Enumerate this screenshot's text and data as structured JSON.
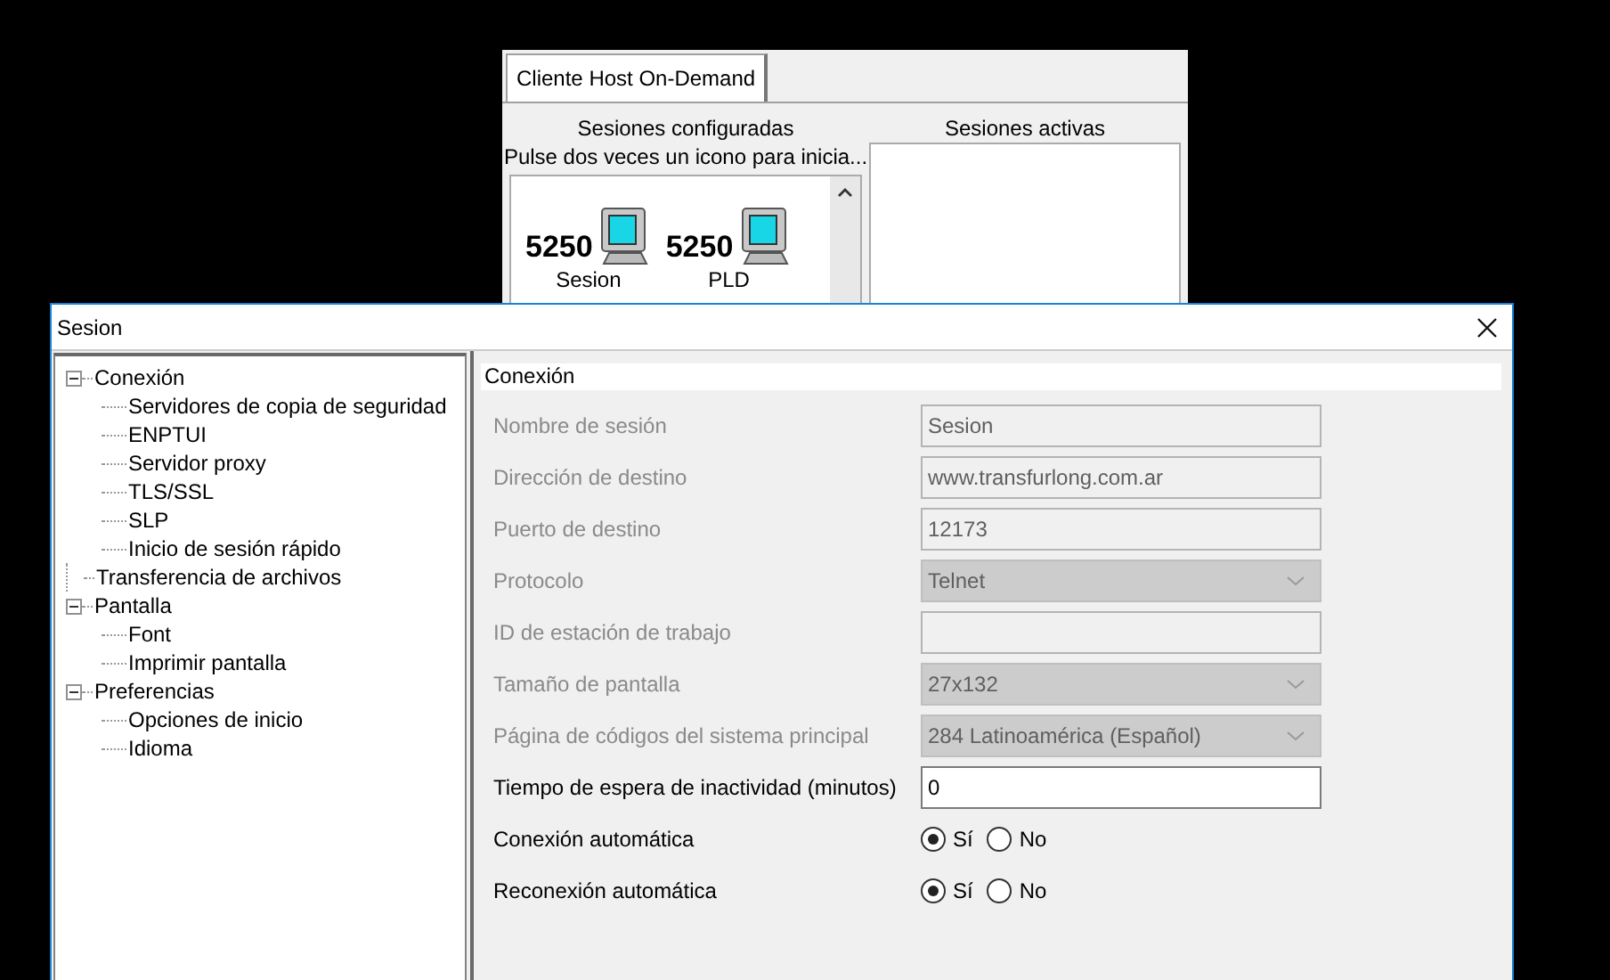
{
  "host_window": {
    "tab": "Cliente Host On-Demand",
    "configured": {
      "title": "Sesiones configuradas",
      "hint": "Pulse dos veces un icono para inicia...",
      "sessions": [
        {
          "code": "5250",
          "name": "Sesion"
        },
        {
          "code": "5250",
          "name": "PLD"
        }
      ]
    },
    "active": {
      "title": "Sesiones activas"
    }
  },
  "dialog": {
    "title": "Sesion",
    "tree": [
      {
        "label": "Conexión",
        "expanded": true,
        "selected": false,
        "children": [
          {
            "label": "Servidores de copia de seguridad",
            "selected": false
          },
          {
            "label": "ENPTUI",
            "selected": false
          },
          {
            "label": "Servidor proxy",
            "selected": false
          },
          {
            "label": "TLS/SSL",
            "selected": false
          },
          {
            "label": "SLP",
            "selected": false
          },
          {
            "label": "Inicio de sesión rápido",
            "selected": false
          }
        ]
      },
      {
        "label": "Transferencia de archivos",
        "selected": false
      },
      {
        "label": "Pantalla",
        "expanded": true,
        "selected": false,
        "children": [
          {
            "label": "Font",
            "selected": false
          },
          {
            "label": "Imprimir pantalla",
            "selected": false
          }
        ]
      },
      {
        "label": "Preferencias",
        "expanded": true,
        "selected": false,
        "children": [
          {
            "label": "Opciones de inicio",
            "selected": false
          },
          {
            "label": "Idioma",
            "selected": false
          }
        ]
      }
    ],
    "section": "Conexión",
    "fields": [
      {
        "kind": "text",
        "label": "Nombre de sesión",
        "value": "Sesion",
        "disabled": true
      },
      {
        "kind": "text",
        "label": "Dirección de destino",
        "value": "www.transfurlong.com.ar",
        "disabled": true
      },
      {
        "kind": "text",
        "label": "Puerto de destino",
        "value": "12173",
        "disabled": true
      },
      {
        "kind": "select",
        "label": "Protocolo",
        "value": "Telnet",
        "disabled": true
      },
      {
        "kind": "text",
        "label": "ID de estación de trabajo",
        "disabled": true
      },
      {
        "kind": "select",
        "label": "Tamaño de pantalla",
        "value": "27x132",
        "disabled": true
      },
      {
        "kind": "select",
        "label": "Página de códigos del sistema principal",
        "value": "284 Latinoamérica (Español)",
        "disabled": true
      },
      {
        "kind": "text",
        "label": "Tiempo de espera de inactividad (minutos)",
        "value": "0",
        "disabled": false
      },
      {
        "kind": "radio",
        "label": "Conexión automática",
        "disabled": false,
        "options": [
          {
            "label": "Sí",
            "selected": true
          },
          {
            "label": "No",
            "selected": false
          }
        ]
      },
      {
        "kind": "radio",
        "label": "Reconexión automática",
        "disabled": false,
        "options": [
          {
            "label": "Sí",
            "selected": true
          },
          {
            "label": "No",
            "selected": false
          }
        ]
      }
    ]
  }
}
